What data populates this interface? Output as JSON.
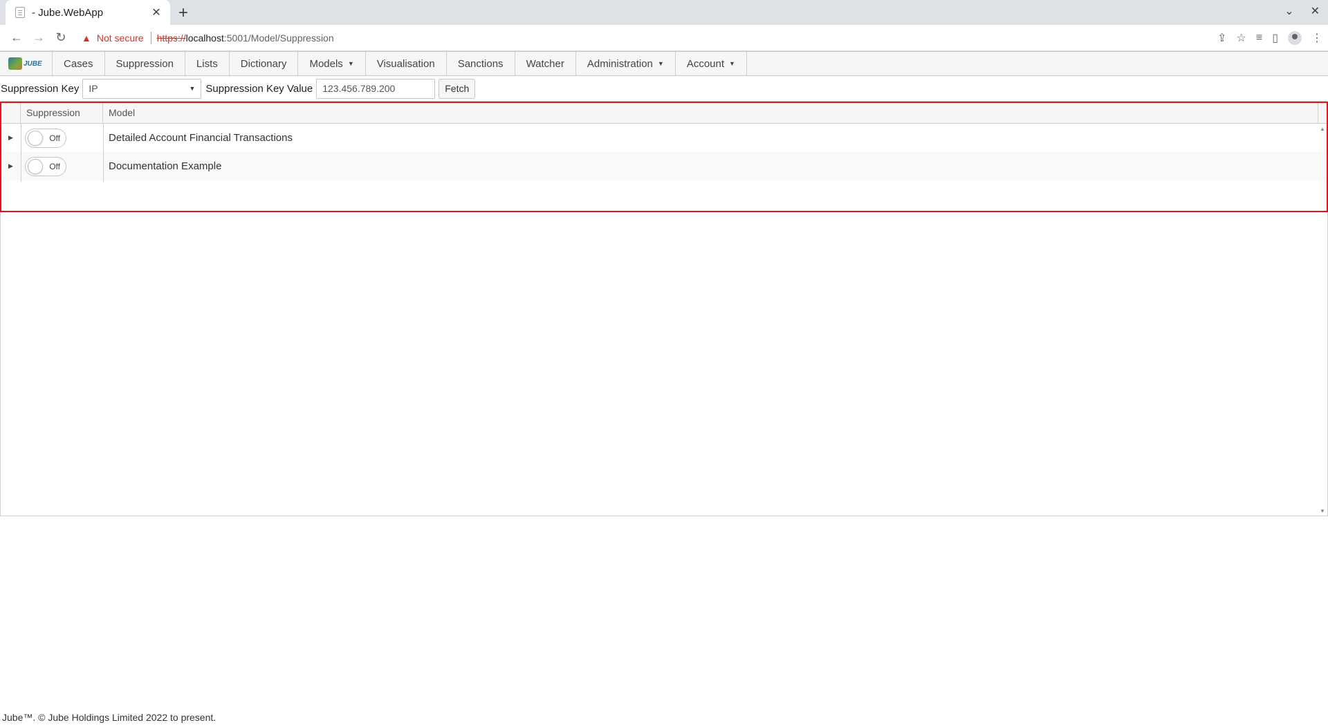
{
  "browser": {
    "tab_title": "- Jube.WebApp",
    "security_label": "Not secure",
    "url_scheme": "https://",
    "url_host": "localhost",
    "url_path": ":5001/Model/Suppression"
  },
  "menu": {
    "logo_text": "JUBE",
    "items": [
      {
        "label": "Cases",
        "dropdown": false
      },
      {
        "label": "Suppression",
        "dropdown": false
      },
      {
        "label": "Lists",
        "dropdown": false
      },
      {
        "label": "Dictionary",
        "dropdown": false
      },
      {
        "label": "Models",
        "dropdown": true
      },
      {
        "label": "Visualisation",
        "dropdown": false
      },
      {
        "label": "Sanctions",
        "dropdown": false
      },
      {
        "label": "Watcher",
        "dropdown": false
      },
      {
        "label": "Administration",
        "dropdown": true
      },
      {
        "label": "Account",
        "dropdown": true
      }
    ]
  },
  "filter": {
    "key_label": "Suppression Key",
    "key_value": "IP",
    "value_label": "Suppression Key Value",
    "value_input": "123.456.789.200",
    "fetch_label": "Fetch"
  },
  "grid": {
    "columns": [
      "Suppression",
      "Model"
    ],
    "rows": [
      {
        "suppression": "Off",
        "model": "Detailed Account Financial Transactions"
      },
      {
        "suppression": "Off",
        "model": "Documentation Example"
      }
    ]
  },
  "footer": "Jube™. © Jube Holdings Limited 2022 to present.",
  "colors": {
    "highlight": "#e0141e",
    "warning": "#d93025"
  }
}
